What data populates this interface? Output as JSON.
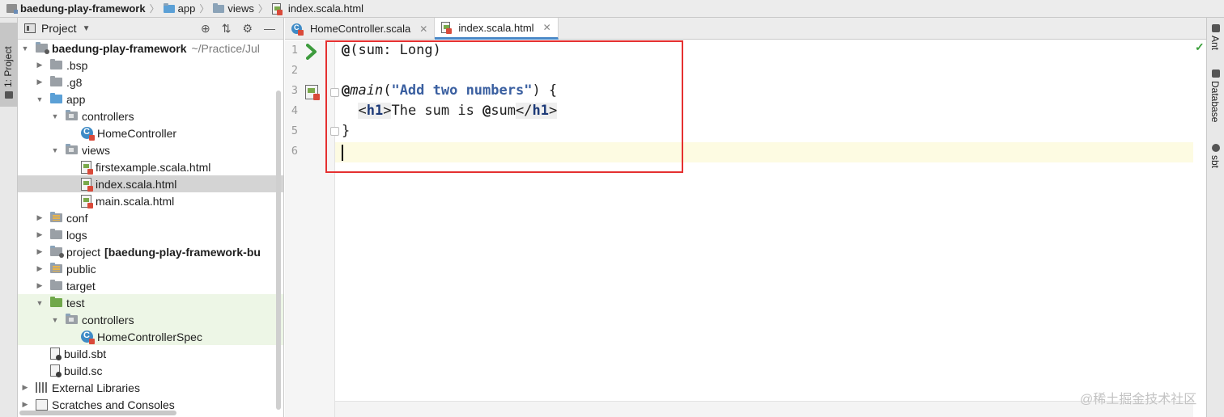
{
  "breadcrumb": {
    "items": [
      "baedung-play-framework",
      "app",
      "views",
      "index.scala.html"
    ]
  },
  "left_strip": {
    "project_tab": "1: Project"
  },
  "project_panel": {
    "title": "Project",
    "tree": [
      {
        "label": "baedung-play-framework",
        "path": "~/Practice/Jul"
      },
      {
        "label": ".bsp"
      },
      {
        "label": ".g8"
      },
      {
        "label": "app"
      },
      {
        "label": "controllers"
      },
      {
        "label": "HomeController"
      },
      {
        "label": "views"
      },
      {
        "label": "firstexample.scala.html"
      },
      {
        "label": "index.scala.html"
      },
      {
        "label": "main.scala.html"
      },
      {
        "label": "conf"
      },
      {
        "label": "logs"
      },
      {
        "label": "project",
        "extra": "[baedung-play-framework-bu"
      },
      {
        "label": "public"
      },
      {
        "label": "target"
      },
      {
        "label": "test"
      },
      {
        "label": "controllers"
      },
      {
        "label": "HomeControllerSpec"
      },
      {
        "label": "build.sbt"
      },
      {
        "label": "build.sc"
      },
      {
        "label": "External Libraries"
      },
      {
        "label": "Scratches and Consoles"
      }
    ]
  },
  "editor": {
    "tabs": [
      {
        "label": "HomeController.scala"
      },
      {
        "label": "index.scala.html"
      }
    ],
    "line_numbers": [
      "1",
      "2",
      "3",
      "4",
      "5",
      "6"
    ],
    "code": {
      "l1_at": "@",
      "l1_rest": "(sum: Long)",
      "l3_at": "@",
      "l3_fn": "main",
      "l3_open": "(",
      "l3_str": "\"Add two numbers\"",
      "l3_close": ") {",
      "l4_indent": "  ",
      "l4_lt1": "<",
      "l4_tag1": "h1",
      "l4_gt1": ">",
      "l4_text": "The sum is ",
      "l4_at": "@",
      "l4_var": "sum",
      "l4_lt2": "</",
      "l4_tag2": "h1",
      "l4_gt2": ">",
      "l5": "}"
    }
  },
  "right_strip": {
    "tabs": [
      "Ant",
      "Database",
      "sbt"
    ]
  },
  "watermark": "@稀土掘金技术社区"
}
